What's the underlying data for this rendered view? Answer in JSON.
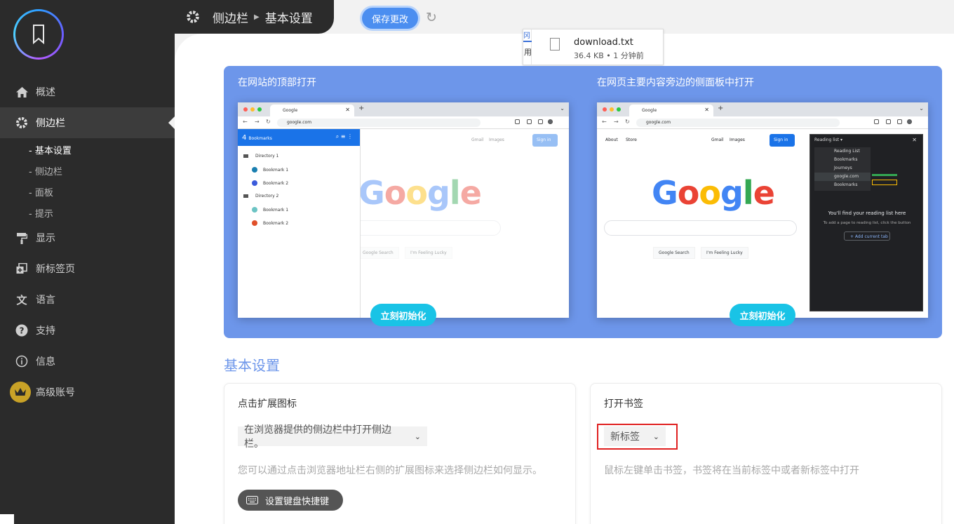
{
  "sidebar": {
    "items": [
      {
        "label": "概述",
        "icon": "home-icon"
      },
      {
        "label": "侧边栏",
        "icon": "gear-icon",
        "active": true
      },
      {
        "label": "显示",
        "icon": "paint-roller-icon"
      },
      {
        "label": "新标签页",
        "icon": "new-tab-icon"
      },
      {
        "label": "语言",
        "icon": "translate-icon"
      },
      {
        "label": "支持",
        "icon": "help-icon"
      },
      {
        "label": "信息",
        "icon": "info-icon"
      },
      {
        "label": "高级账号",
        "icon": "crown-icon"
      }
    ],
    "subitems": [
      "- 基本设置",
      "- 侧边栏",
      "- 面板",
      "- 提示"
    ]
  },
  "header": {
    "crumb1": "侧边栏",
    "crumb2": "基本设置",
    "save_label": "保存更改"
  },
  "download": {
    "filename": "download.txt",
    "meta": "36.4 KB • 1 分钟前",
    "edge_top": "冈",
    "edge_text": "用"
  },
  "banner": {
    "left_title": "在网站的顶部打开",
    "right_title": "在网页主要内容旁边的侧面板中打开",
    "init_label": "立刻初始化",
    "mock": {
      "tab_title": "Google",
      "url": "google.com",
      "bookmarks_count": "4",
      "bookmarks_label": "Bookmarks",
      "dir1": "Directory 1",
      "dir2": "Directory 2",
      "bm1": "Bookmark 1",
      "bm2": "Bookmark 2",
      "gmail": "Gmail",
      "images": "Images",
      "signin": "Sign in",
      "about": "About",
      "store": "Store",
      "google_search": "Google Search",
      "lucky": "I'm Feeling Lucky",
      "rl_title": "Reading list",
      "rl_items": [
        "Reading List",
        "Bookmarks",
        "Journeys",
        "google.com",
        "Bookmarks"
      ],
      "rl_heading": "You'll find your reading list here",
      "rl_sub": "To add a page to reading list, click the button",
      "rl_add": "+ Add current tab"
    }
  },
  "section": {
    "title": "基本设置",
    "card1": {
      "title": "点击扩展图标",
      "select_value": "在浏览器提供的侧边栏中打开侧边栏。",
      "hint": "您可以通过点击浏览器地址栏右侧的扩展图标来选择侧边栏如何显示。",
      "button": "设置键盘快捷键"
    },
    "card2": {
      "title": "打开书签",
      "select_value": "新标签",
      "hint": "鼠标左键单击书签，书签将在当前标签中或者新标签中打开"
    }
  },
  "colors": {
    "sidebar_bg": "#2b2b2b",
    "accent": "#6d96ea",
    "save_button": "#4b8ef0",
    "init_button": "#19c3e6",
    "highlight_box": "#e02020"
  }
}
